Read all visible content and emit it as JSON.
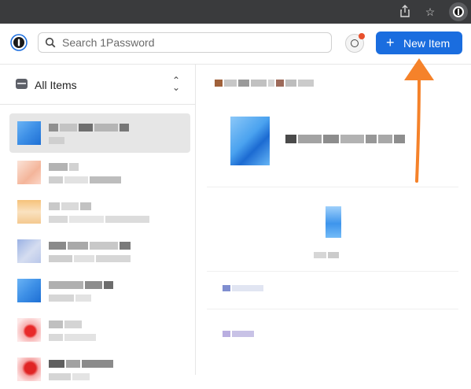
{
  "browser": {
    "share_icon": "share-icon",
    "star_icon": "star-icon",
    "extension_icon": "1password-extension-icon"
  },
  "header": {
    "logo": "1password-logo",
    "search_placeholder": "Search 1Password",
    "watchtower_icon": "watchtower-icon",
    "new_item_label": "New Item"
  },
  "sidebar": {
    "vault_label": "All Items",
    "item_count": 7
  },
  "colors": {
    "accent": "#1a6ddf",
    "arrow": "#f5822a"
  }
}
